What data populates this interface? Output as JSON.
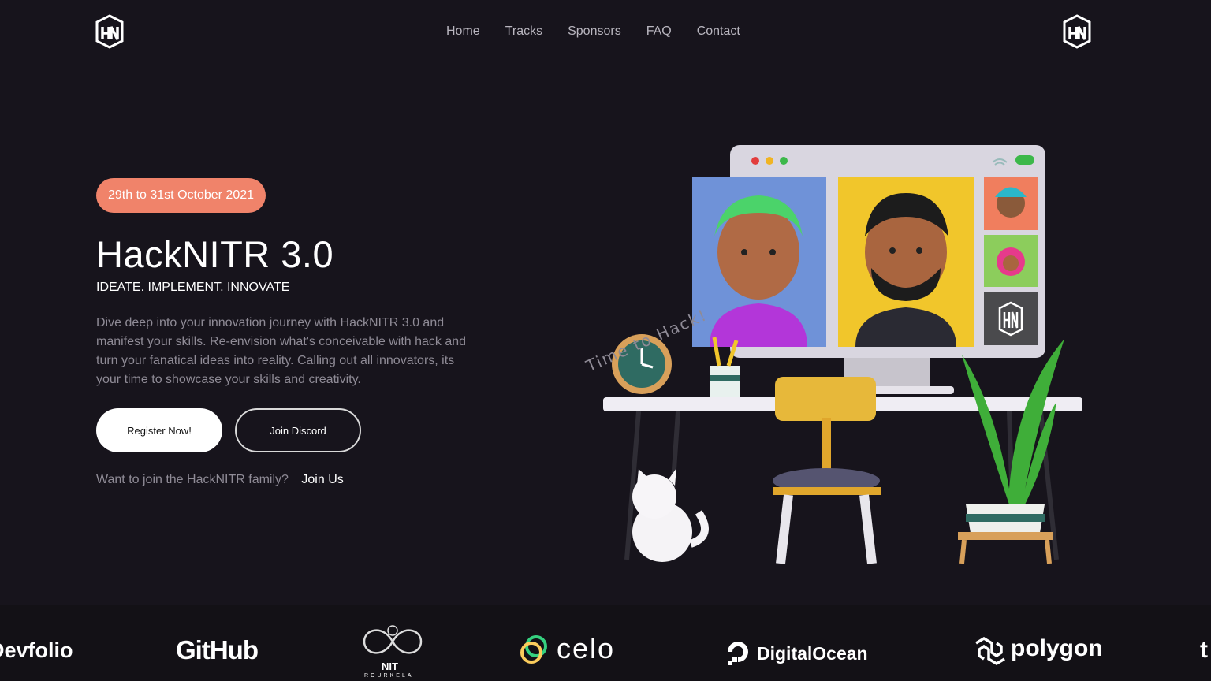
{
  "nav": {
    "links": [
      "Home",
      "Tracks",
      "Sponsors",
      "FAQ",
      "Contact"
    ]
  },
  "hero": {
    "date_badge": "29th to 31st October 2021",
    "title": "HackNITR 3.0",
    "tagline": "IDEATE. IMPLEMENT. INNOVATE",
    "description": "Dive deep into your innovation journey with HackNITR 3.0 and manifest your skills. Re-envision what's conceivable with hack and turn your fanatical ideas into reality. Calling out all innovators, its your time to showcase your skills and creativity.",
    "register_label": "Register Now!",
    "discord_label": "Join Discord",
    "join_question": "Want to join the HackNITR family?",
    "join_link": "Join Us"
  },
  "illustration": {
    "caption": "Time to Hack!"
  },
  "sponsors": {
    "items": [
      "Devfolio",
      "GitHub",
      "NIT",
      "ROURKELA",
      "celo",
      "DigitalOcean",
      "polygon"
    ]
  },
  "colors": {
    "background": "#17141c",
    "badge": "#f0836a",
    "muted_text": "#8f8b96",
    "sponsor_strip": "#131116"
  },
  "icons": {
    "logo": "hacknitr-logo-icon"
  }
}
